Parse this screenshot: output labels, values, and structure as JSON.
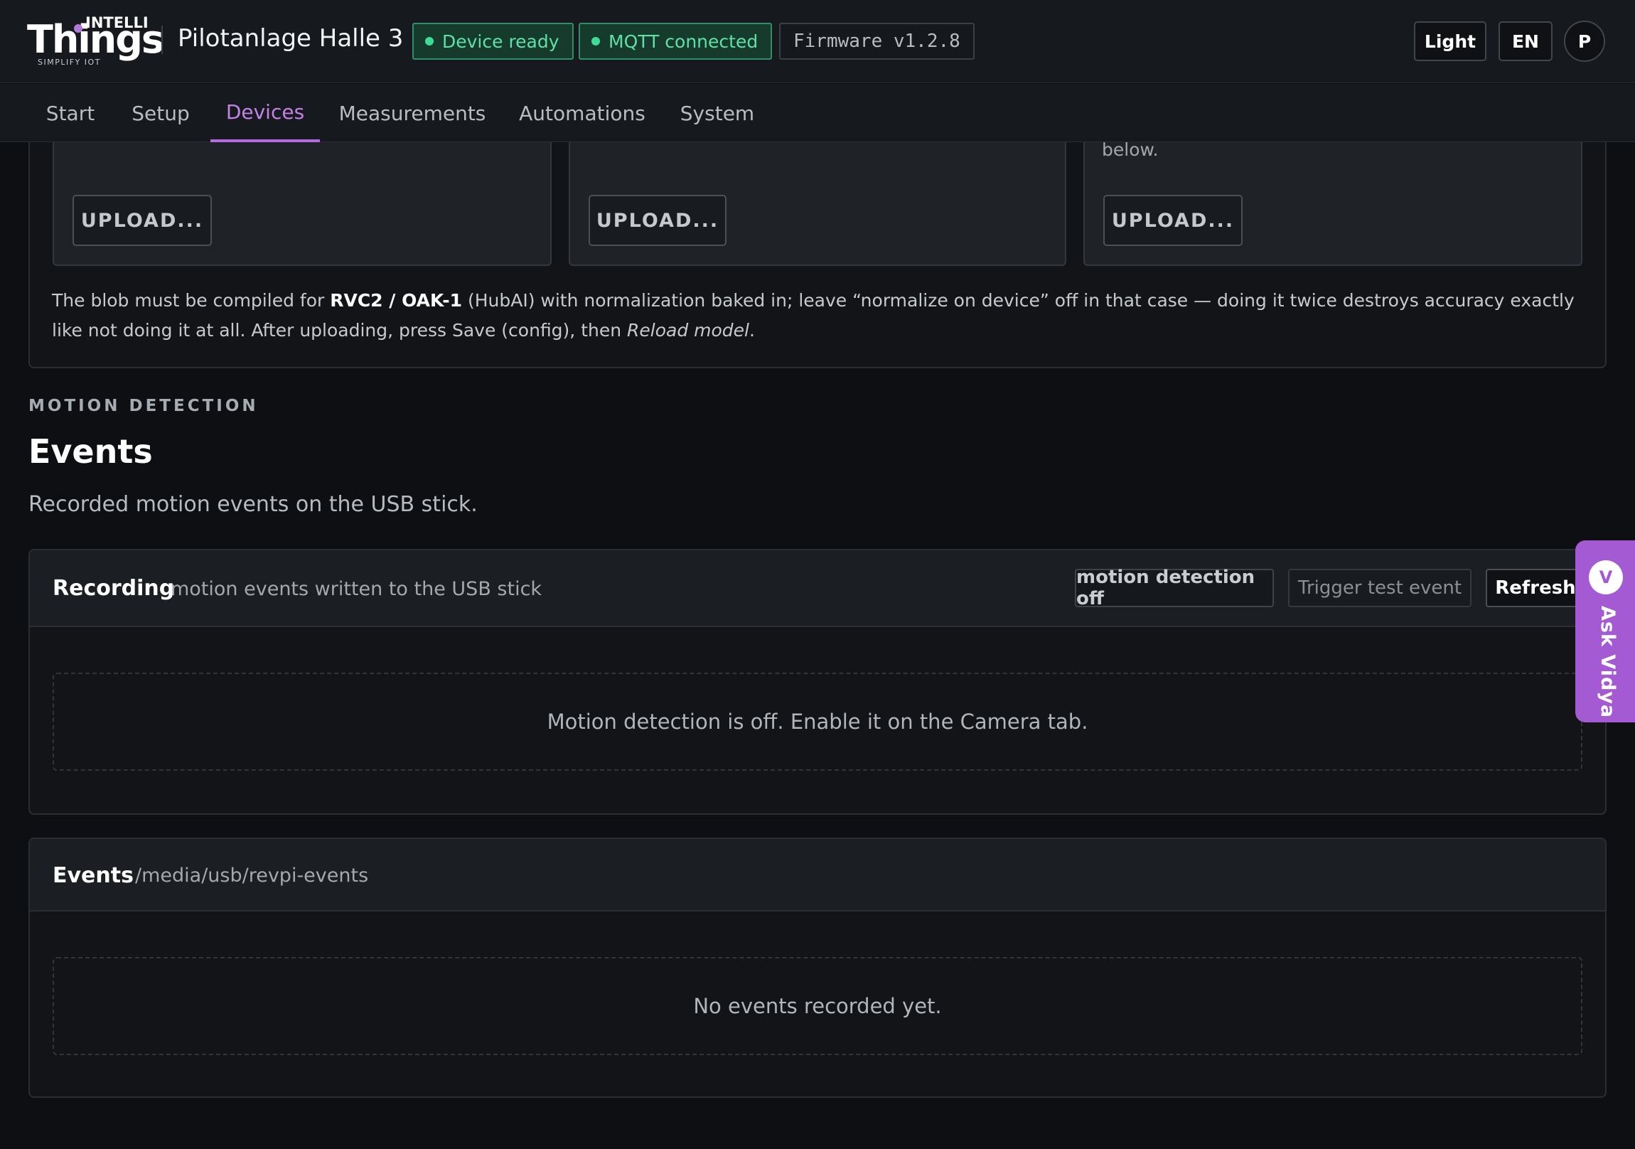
{
  "brand": {
    "logo_top": "INTELLI",
    "logo_main": "Things",
    "logo_sub": "SIMPLIFY IOT"
  },
  "header": {
    "site_name": "Pilotanlage Halle 3",
    "status_device": "Device ready",
    "status_mqtt": "MQTT connected",
    "firmware": "Firmware v1.2.8",
    "theme_button": "Light",
    "language_button": "EN",
    "avatar_initial": "P"
  },
  "nav": {
    "tabs": [
      {
        "label": "Start",
        "active": false
      },
      {
        "label": "Setup",
        "active": false
      },
      {
        "label": "Devices",
        "active": true
      },
      {
        "label": "Measurements",
        "active": false
      },
      {
        "label": "Automations",
        "active": false
      },
      {
        "label": "System",
        "active": false
      }
    ]
  },
  "model_upload": {
    "upload_labels": [
      "UPLOAD...",
      "UPLOAD...",
      "UPLOAD..."
    ],
    "card3_tail_text": "below.",
    "note": {
      "p1": "The blob must be compiled for ",
      "bold": "RVC2 / OAK-1",
      "p2": " (HubAI) with normalization baked in; leave “normalize on device” off in that case — doing it twice destroys accuracy exactly like not doing it at all. After uploading, press Save (config), then ",
      "italic": "Reload model",
      "p3": "."
    }
  },
  "section": {
    "eyebrow": "MOTION DETECTION",
    "title": "Events",
    "description": "Recorded motion events on the USB stick."
  },
  "recording_panel": {
    "title": "Recording",
    "subtitle": "motion events written to the USB stick",
    "status_chip": "motion detection off",
    "trigger_button": "Trigger test event",
    "refresh_button": "Refresh",
    "empty_message": "Motion detection is off. Enable it on the Camera tab."
  },
  "events_panel": {
    "title": "Events",
    "path": "/media/usb/revpi-events",
    "empty_message": "No events recorded yet."
  },
  "assistant": {
    "badge": "V",
    "label": "Ask Vidya"
  },
  "colors": {
    "accent": "#b26de0",
    "status_green": "#3ddc97",
    "assistant_purple": "#a45ad2"
  }
}
